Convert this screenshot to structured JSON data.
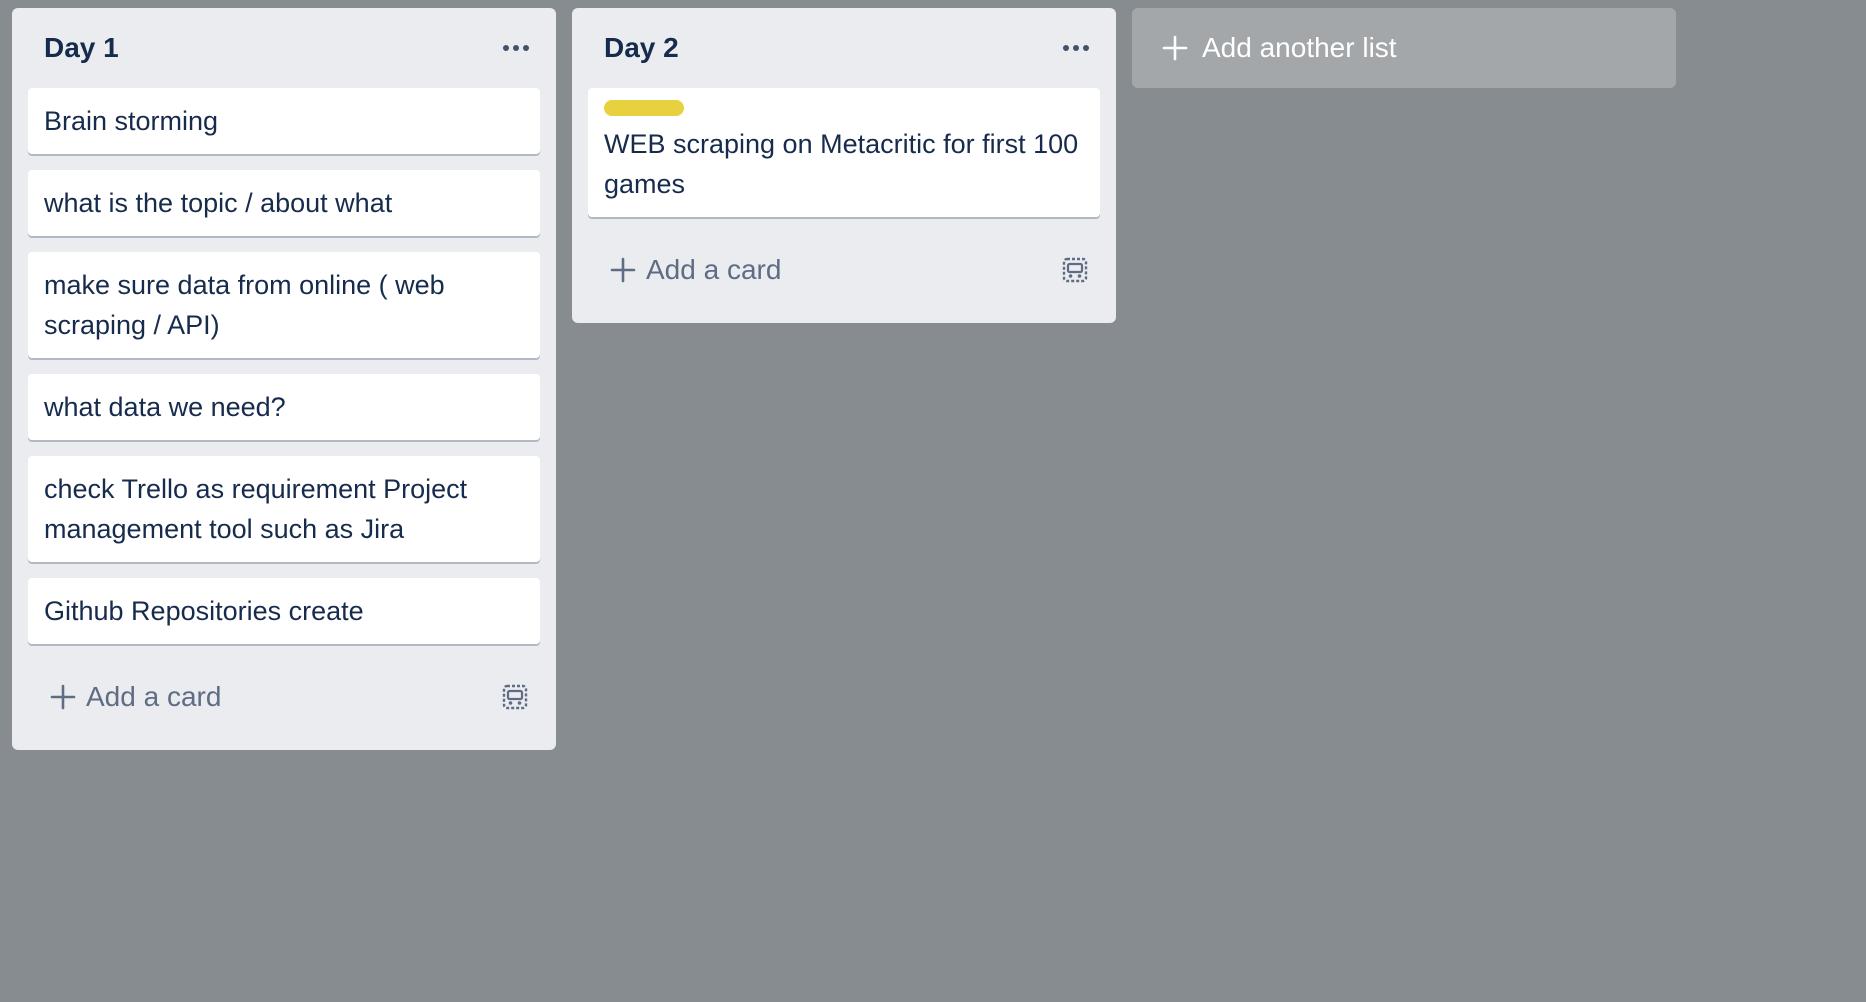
{
  "colors": {
    "board_bg": "#868c90",
    "list_bg": "#ebecf0",
    "card_bg": "#ffffff",
    "text": "#172b4d",
    "muted": "#5e6c84",
    "label_yellow": "#e7d13f"
  },
  "lists": [
    {
      "title": "Day 1",
      "menu_icon": "more-horizontal-icon",
      "cards": [
        {
          "text": "Brain storming"
        },
        {
          "text": "what is the topic / about what"
        },
        {
          "text": "make sure data from online ( web scraping / API)"
        },
        {
          "text": "what data we need?"
        },
        {
          "text": "check Trello as requirement Project management tool such as Jira"
        },
        {
          "text": "Github Repositories create"
        }
      ],
      "add_card_label": "Add a card",
      "template_icon": "card-template-icon"
    },
    {
      "title": "Day 2",
      "menu_icon": "more-horizontal-icon",
      "cards": [
        {
          "text": "WEB scraping on Metacritic for first 100 games",
          "label_color": "#e7d13f"
        }
      ],
      "add_card_label": "Add a card",
      "template_icon": "card-template-icon"
    }
  ],
  "add_list": {
    "label": "Add another list",
    "icon": "plus-icon"
  }
}
